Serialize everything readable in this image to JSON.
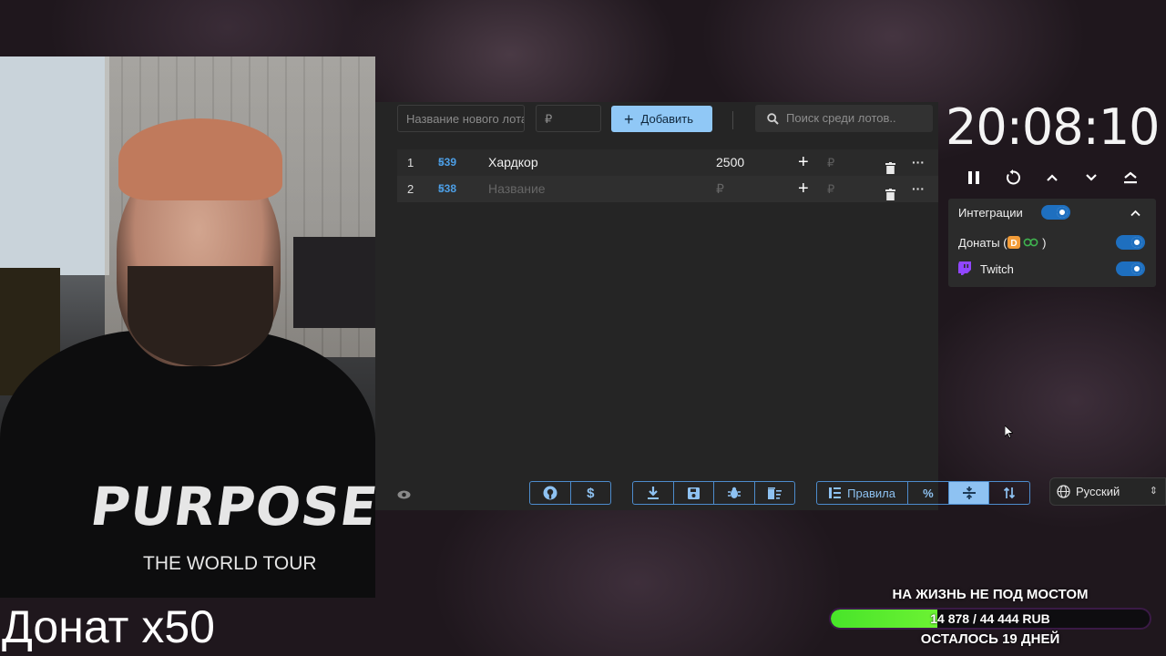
{
  "app": {
    "new_lot_placeholder": "Название нового лота",
    "amount_placeholder": "₽",
    "add_button": "Добавить",
    "search_placeholder": "Поиск среди лотов..",
    "lots": [
      {
        "num": "1",
        "id": "539",
        "name": "Хардкор",
        "amount": "2500",
        "rub": "₽"
      },
      {
        "num": "2",
        "id": "538",
        "name_placeholder": "Название",
        "amount_placeholder": "₽",
        "rub": "₽"
      }
    ],
    "more_glyph": "···",
    "hash_glyph": "#",
    "rules_label": "Правила",
    "percent_label": "%"
  },
  "timer": {
    "time": "20:08:10"
  },
  "integrations": {
    "title": "Интеграции",
    "donations_label_prefix": "Донаты (",
    "donations_label_suffix": " )",
    "twitch_label": "Twitch",
    "enabled": true
  },
  "language": {
    "selected": "Русский"
  },
  "overlay": {
    "donat_multiplier": "Донат x50",
    "goal_title": "НА ЖИЗНЬ НЕ ПОД МОСТОМ",
    "goal_progress": "14 878 / 44 444 RUB",
    "goal_fraction": 0.335,
    "goal_remaining": "ОСТАЛОСЬ 19 ДНЕЙ"
  },
  "webcam": {
    "shirt_text": "PURPOSE",
    "shirt_subtext": "THE WORLD TOUR"
  },
  "colors": {
    "accent": "#90c8f6",
    "link": "#4d9fe6",
    "toggle": "#1e6fbf",
    "goal_fill": "#48e42a"
  }
}
